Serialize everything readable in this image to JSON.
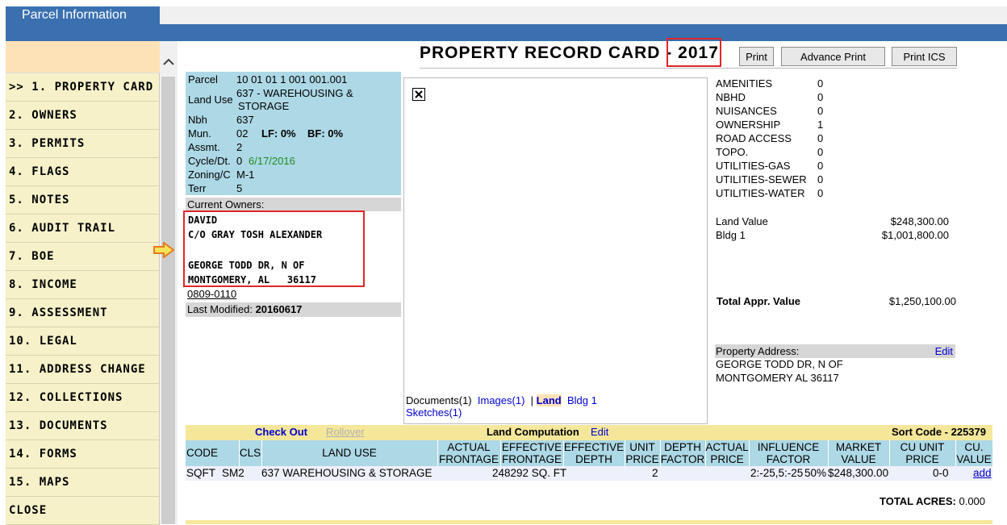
{
  "tab_label": "Parcel Information",
  "sidebar": {
    "items": [
      ">> 1. PROPERTY CARD",
      "2. OWNERS",
      "3. PERMITS",
      "4. FLAGS",
      "5. NOTES",
      "6. AUDIT TRAIL",
      "7. BOE",
      "8. INCOME",
      "9. ASSESSMENT",
      "10. LEGAL",
      "11. ADDRESS CHANGE",
      "12. COLLECTIONS",
      "13. DOCUMENTS",
      "14. FORMS",
      "15. MAPS",
      "CLOSE"
    ]
  },
  "header": {
    "title": "PROPERTY RECORD CARD -",
    "year": "2017",
    "buttons": [
      "Print",
      "Advance Print",
      "Print ICS"
    ]
  },
  "parcel": {
    "parcel_label": "Parcel",
    "parcel_value": "10 01 01 1 001 001.001",
    "land_use_label": "Land Use",
    "land_use_value_1": "637 - WAREHOUSING &",
    "land_use_value_2": "STORAGE",
    "nbh_label": "Nbh",
    "nbh_value": "637",
    "mun_label": "Mun.",
    "mun_value": "02",
    "lf": "LF: 0%",
    "bf": "BF: 0%",
    "assmt_label": "Assmt.",
    "assmt_value": "2",
    "cycle_label": "Cycle/Dt.",
    "cycle_value": "0",
    "cycle_date": "6/17/2016",
    "zoning_label": "Zoning/C",
    "zoning_value": "M-1",
    "terr_label": "Terr",
    "terr_value": "5"
  },
  "owners": {
    "heading": "Current Owners:",
    "lines": [
      "DAVID",
      "C/O GRAY TOSH ALEXANDER",
      "",
      "GEORGE TODD DR, N OF",
      "MONTGOMERY, AL   36117"
    ],
    "parcel_link": "0809-0110",
    "last_modified_label": "Last Modified:",
    "last_modified_value": "20160617"
  },
  "media": {
    "documents": "Documents(1)",
    "images": "Images(1)",
    "sep": "|",
    "land": "Land",
    "bldg": "Bldg 1",
    "sketches": "Sketches(1)"
  },
  "amenities": [
    {
      "label": "AMENITIES",
      "value": "0"
    },
    {
      "label": "NBHD",
      "value": "0"
    },
    {
      "label": "NUISANCES",
      "value": "0"
    },
    {
      "label": "OWNERSHIP",
      "value": "1"
    },
    {
      "label": "ROAD ACCESS",
      "value": "0"
    },
    {
      "label": "TOPO.",
      "value": "0"
    },
    {
      "label": "UTILITIES-GAS",
      "value": "0"
    },
    {
      "label": "UTILITIES-SEWER",
      "value": "0"
    },
    {
      "label": "UTILITIES-WATER",
      "value": "0"
    }
  ],
  "values": {
    "land_label": "Land Value",
    "land_value": "$248,300.00",
    "bldg_label": "Bldg 1",
    "bldg_value": "$1,001,800.00",
    "total_label": "Total Appr. Value",
    "total_value": "$1,250,100.00"
  },
  "address": {
    "heading": "Property Address:",
    "edit": "Edit",
    "line1": "GEORGE TODD DR, N OF",
    "line2": "MONTGOMERY AL 36117"
  },
  "land_table": {
    "check_out": "Check Out",
    "rollover": "Rollover",
    "land_computation": "Land Computation",
    "edit": "Edit",
    "sort_code": "Sort Code - 225379",
    "headers": [
      "CODE",
      "CLS",
      "LAND USE",
      "ACTUAL FRONTAGE",
      "EFFECTIVE FRONTAGE",
      "EFFECTIVE DEPTH",
      "UNIT PRICE",
      "DEPTH FACTOR",
      "ACTUAL PRICE",
      "INFLUENCE FACTOR",
      "MARKET VALUE",
      "CU UNIT PRICE",
      "CU. VALUE"
    ],
    "row": {
      "code": "SQFT",
      "cls": "SM2",
      "land_use": "637 WAREHOUSING & STORAGE",
      "frontage": "248292 SQ. FT",
      "unit_price": "2",
      "influence": "2:-25,5:-25",
      "percent": "50%",
      "market_value": "$248,300.00",
      "cu_unit_price": "0-0",
      "cu_value": "add"
    },
    "total_acres_label": "TOTAL ACRES:",
    "total_acres_value": "0.000"
  }
}
